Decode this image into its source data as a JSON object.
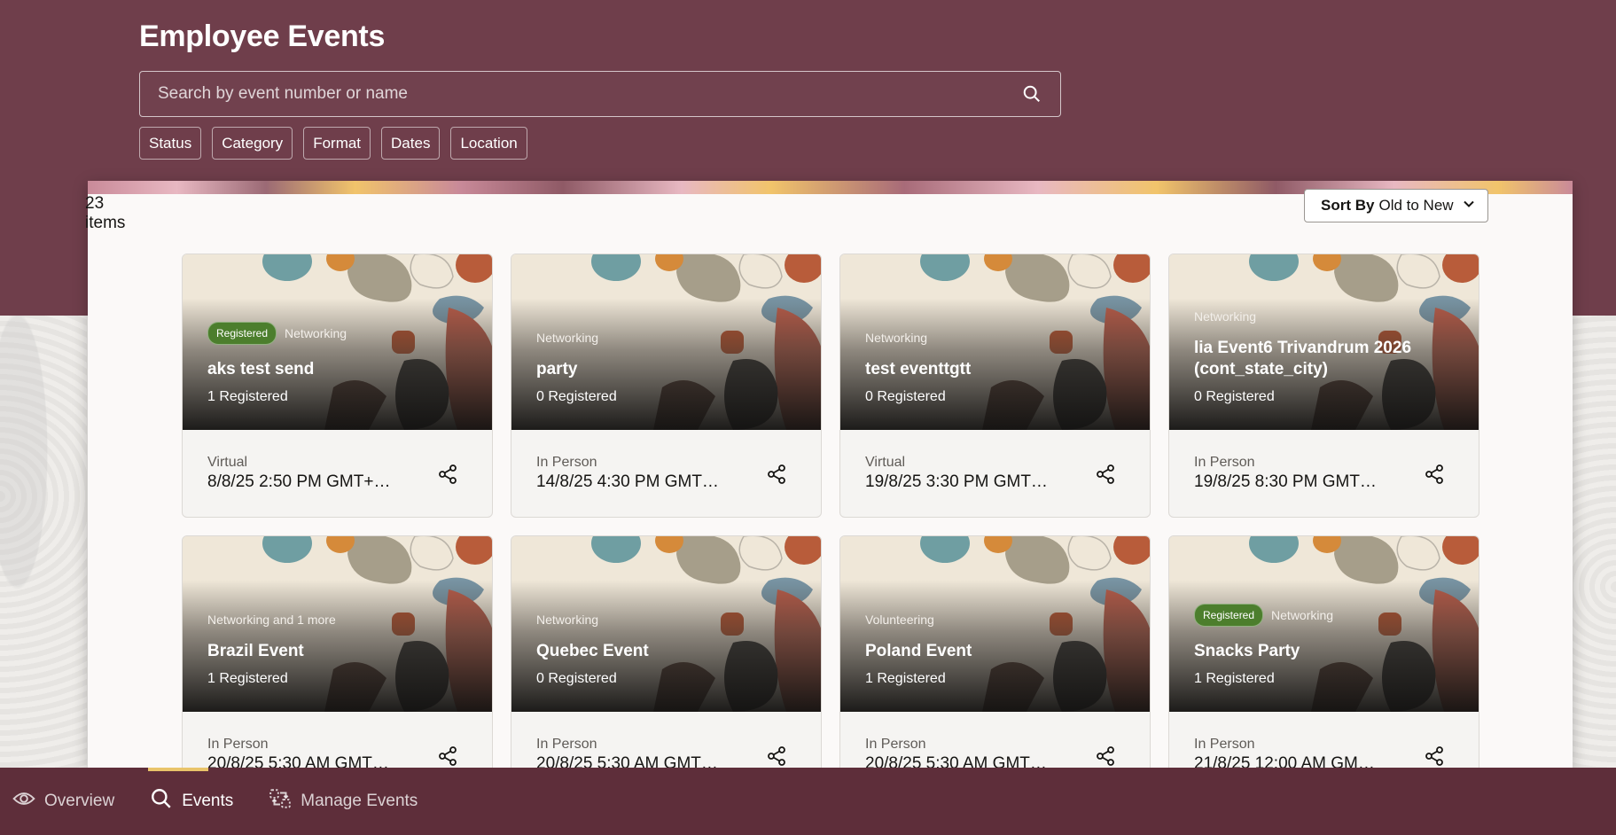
{
  "header": {
    "title": "Employee Events",
    "search_placeholder": "Search by event number or name",
    "filters": [
      "Status",
      "Category",
      "Format",
      "Dates",
      "Location"
    ]
  },
  "results": {
    "count_text": "23 items",
    "sort_label": "Sort By",
    "sort_value": "Old to New"
  },
  "events": [
    {
      "badge": "Registered",
      "category": "Networking",
      "name": "aks test send",
      "registered": "1 Registered",
      "format": "Virtual",
      "datetime": "8/8/25 2:50 PM GMT+…"
    },
    {
      "badge": "",
      "category": "Networking",
      "name": "party",
      "registered": "0 Registered",
      "format": "In Person",
      "datetime": "14/8/25 4:30 PM GMT…"
    },
    {
      "badge": "",
      "category": "Networking",
      "name": "test eventtgtt",
      "registered": "0 Registered",
      "format": "Virtual",
      "datetime": "19/8/25 3:30 PM GMT…"
    },
    {
      "badge": "",
      "category": "Networking",
      "name": "lia Event6 Trivandrum 2026 (cont_state_city)",
      "registered": "0 Registered",
      "format": "In Person",
      "datetime": "19/8/25 8:30 PM GMT…"
    },
    {
      "badge": "",
      "category": "Networking and 1 more",
      "name": "Brazil Event",
      "registered": "1 Registered",
      "format": "In Person",
      "datetime": "20/8/25 5:30 AM GMT…"
    },
    {
      "badge": "",
      "category": "Networking",
      "name": "Quebec Event",
      "registered": "0 Registered",
      "format": "In Person",
      "datetime": "20/8/25 5:30 AM GMT…"
    },
    {
      "badge": "",
      "category": "Volunteering",
      "name": "Poland Event",
      "registered": "1 Registered",
      "format": "In Person",
      "datetime": "20/8/25 5:30 AM GMT…"
    },
    {
      "badge": "Registered",
      "category": "Networking",
      "name": "Snacks Party",
      "registered": "1 Registered",
      "format": "In Person",
      "datetime": "21/8/25 12:00 AM GM…"
    }
  ],
  "bottom_nav": [
    {
      "label": "Overview",
      "icon": "eye-icon",
      "active": false
    },
    {
      "label": "Events",
      "icon": "search-icon",
      "active": true
    },
    {
      "label": "Manage Events",
      "icon": "manage-events-icon",
      "active": false
    }
  ],
  "colors": {
    "header_bg": "#6f3e4b",
    "nav_bg": "#5e2e3a",
    "badge_green": "#4c7e2d",
    "active_indicator": "#e9c46a"
  }
}
